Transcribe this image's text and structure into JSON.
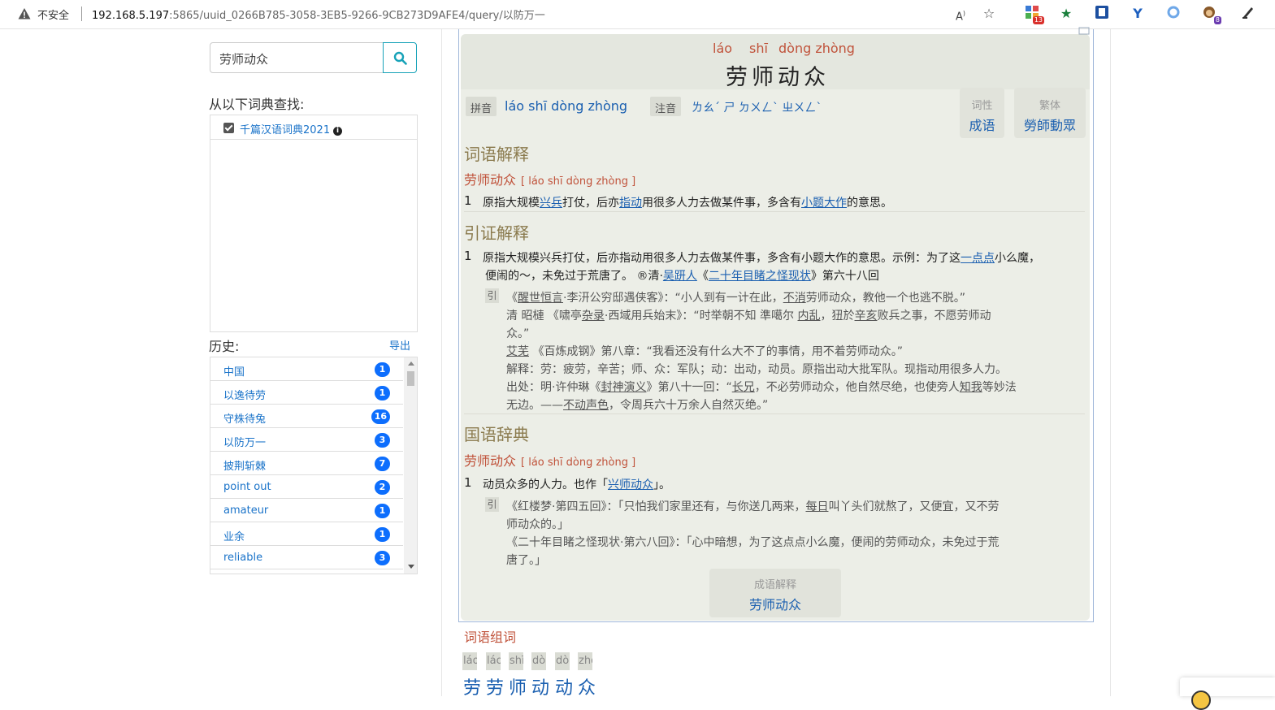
{
  "browser": {
    "insecure_label": "不安全",
    "url_host": "192.168.5.197",
    "url_path": ":5865/uuid_0266B785-3058-3EB5-9266-9CB273D9AFE4/query/以防万一",
    "ext_badge_1": "13",
    "ext_badge_2": "8"
  },
  "search": {
    "value": "劳师动众"
  },
  "dict_section": {
    "label": "从以下词典查找:",
    "items": [
      {
        "name": "千篇汉语词典2021",
        "checked": true
      }
    ]
  },
  "history": {
    "label": "历史:",
    "export": "导出",
    "items": [
      {
        "word": "中国",
        "count": "1"
      },
      {
        "word": "以逸待劳",
        "count": "1"
      },
      {
        "word": "守株待兔",
        "count": "16"
      },
      {
        "word": "以防万一",
        "count": "3"
      },
      {
        "word": "披荆斩棘",
        "count": "7"
      },
      {
        "word": "point out",
        "count": "2"
      },
      {
        "word": "amateur",
        "count": "1"
      },
      {
        "word": "业余",
        "count": "1"
      },
      {
        "word": "reliable",
        "count": "3"
      }
    ]
  },
  "entry": {
    "pinyin_parts": [
      "láo",
      "shī",
      "dòng zhòng"
    ],
    "title": "劳师动众",
    "pinyin_tag": "拼音",
    "pinyin_full": "láo shī dòng zhòng",
    "zhuyin_tag": "注音",
    "zhuyin": "ㄌㄠˊ ㄕ ㄉㄨㄥˋ ㄓㄨㄥˋ",
    "pos_label": "词性",
    "pos_value": "成语",
    "trad_label": "繁体",
    "trad_value": "勞師動眾"
  },
  "sec1": {
    "title": "词语解释",
    "head": "劳师动众",
    "head_py": "[ láo shī dòng zhòng ]",
    "num": "1",
    "text_a": "原指大规模",
    "link_a": "兴兵",
    "text_b": "打仗，后亦",
    "link_b": "指动",
    "text_c": "用很多人力去做某件事，多含有",
    "link_c": "小题大作",
    "text_d": "的意思。"
  },
  "sec2": {
    "title": "引证解释",
    "num": "1",
    "line1_a": "原指大规模兴兵打仗，后亦指动用很多人力去做某件事，多含有小题大作的意思。示例：为了这",
    "line1_link": "一点点",
    "line1_b": "小么魔，",
    "line2_a": "便闹的～，未免过于荒唐了。 ®清·",
    "line2_link1": "吴趼人",
    "line2_mid": "《",
    "line2_link2": "二十年目睹之怪现状",
    "line2_end": "》第六十八回",
    "yin": "引",
    "q1_a": "《",
    "q1_u1": "醒世恒言",
    "q1_b": "·李汧公穷邸遇侠客》：“小人到有一计在此，",
    "q1_u2": "不消",
    "q1_c": "劳师动众，教他一个也逃不脱。”",
    "q2_a": "清 昭槤 《啸亭",
    "q2_u1": "杂录",
    "q2_b": "·西域用兵始末》：“时举朝不知 準噶尔 ",
    "q2_u2": "内乱",
    "q2_c": "，狃於",
    "q2_u3": "辛亥",
    "q2_d": "败兵之事，不愿劳师动",
    "q2_e": "众。”",
    "q3_u": "艾芜",
    "q3_b": " 《百炼成钢》第八章：“我看还没有什么大不了的事情，用不着劳师动众。”",
    "q4": "解释：劳：疲劳，辛苦；师、众：军队；动：出动，动员。原指出动大批军队。现指动用很多人力。",
    "q5_a": "出处：明·许仲琳《",
    "q5_u1": "封神演义",
    "q5_b": "》第八十一回：“",
    "q5_u2": "长兄",
    "q5_c": "，不必劳师动众，他自然尽绝，也使旁人",
    "q5_u3": "知我",
    "q5_d": "等妙法",
    "q6_a": "无边。——",
    "q6_u": "不动声色",
    "q6_b": "，令周兵六十万余人自然灭绝。”"
  },
  "sec3": {
    "title": "国语辞典",
    "head": "劳师动众",
    "head_py": "[ láo shī dòng zhòng ]",
    "num": "1",
    "def_a": "动员众多的人力。也作「",
    "def_link": "兴师动众",
    "def_b": "」。",
    "yin": "引",
    "q1_a": "《红楼梦·第四五回》：「只怕我们家里还有，与你送几两来，",
    "q1_u": "每日",
    "q1_b": "叫丫头们就熬了，又便宜，又不劳",
    "q1_c": "师动众的。」",
    "q2_a": "《二十年目睹之怪现状·第六八回》：「心中暗想，为了这点点小么魔，便闹的劳师动众，未免过于荒",
    "q2_b": "唐了。」"
  },
  "idiom_box": {
    "label": "成语解释",
    "value": "劳师动众"
  },
  "zuci": {
    "title": "词语组词",
    "pinyin": [
      "láo",
      "láo",
      "shī",
      "dòng",
      "dòng",
      "zhòng"
    ],
    "chars": [
      "劳",
      "劳",
      "师",
      "动",
      "动",
      "众"
    ]
  }
}
